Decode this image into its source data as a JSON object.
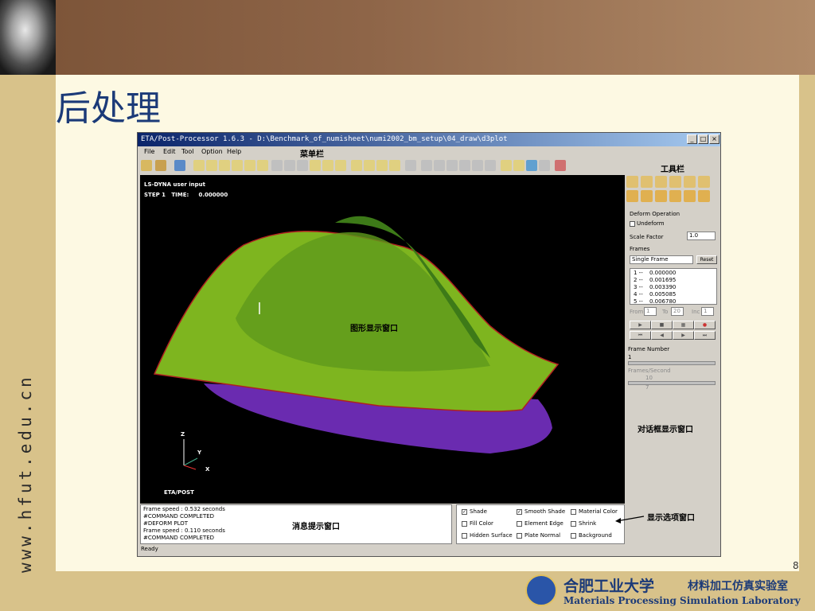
{
  "slide": {
    "title": "后处理",
    "side_url": "www.hfut.edu.cn",
    "page_number": "8",
    "logo_cn": "合肥工业大学",
    "logo_lab": "材料加工仿真实验室",
    "logo_en": "Materials Processing Simulation Laboratory"
  },
  "app": {
    "title": "ETA/Post-Processor 1.6.3 - D:\\Benchmark_of_numisheet\\numi2002_bm_setup\\04_draw\\d3plot",
    "win_min": "_",
    "win_max": "□",
    "win_close": "×",
    "menus": [
      "File",
      "Edit",
      "Tool",
      "Option",
      "Help"
    ],
    "status": "Ready"
  },
  "annotations": {
    "menubar": "菜单栏",
    "toolbar": "工具栏",
    "graphics": "图形显示窗口",
    "dialog": "对话框显示窗口",
    "message": "消息提示窗口",
    "options": "显示选项窗口"
  },
  "viewport": {
    "header1": "LS-DYNA user input",
    "header2": "STEP 1   TIME:     0.000000",
    "axis_z": "Z",
    "axis_y": "Y",
    "axis_x": "X",
    "brand": "ETA/POST",
    "colors": {
      "green": "#7eb51f",
      "dark_green": "#3d7a18",
      "purple": "#6a2bb0",
      "red_edge": "#b02020"
    }
  },
  "panel": {
    "deform_operation": "Deform Operation",
    "undeform": "Undeform",
    "scale_factor_label": "Scale Factor",
    "scale_factor_value": "1.0",
    "frames_label": "Frames",
    "frame_mode": "Single Frame",
    "reset": "Reset",
    "frame_list": [
      {
        "idx": "1 --",
        "val": "0.000000"
      },
      {
        "idx": "2 --",
        "val": "0.001695"
      },
      {
        "idx": "3 --",
        "val": "0.003390"
      },
      {
        "idx": "4 --",
        "val": "0.005085"
      },
      {
        "idx": "5 --",
        "val": "0.006780"
      }
    ],
    "from_label": "From",
    "from_value": "1",
    "to_label": "To",
    "to_value": "20",
    "inc_label": "Inc",
    "inc_value": "1",
    "frame_number_label": "Frame Number",
    "frame_number_value": "1",
    "frames_second_label": "Frames/Second",
    "frames_second_value": "10",
    "frames_second_value2": "7"
  },
  "messages": [
    "Frame speed :  0.532 seconds",
    "#COMMAND COMPLETED",
    "#DEFORM PLOT",
    "Frame speed :  0.110 seconds",
    "#COMMAND COMPLETED"
  ],
  "options": {
    "shade": "Shade",
    "smooth_shade": "Smooth Shade",
    "material_color": "Material Color",
    "fill_color": "Fill Color",
    "element_edge": "Element Edge",
    "shrink": "Shrink",
    "hidden_surface": "Hidden Surface",
    "plate_normal": "Plate Normal",
    "background": "Background",
    "checked_mark": "✓"
  }
}
